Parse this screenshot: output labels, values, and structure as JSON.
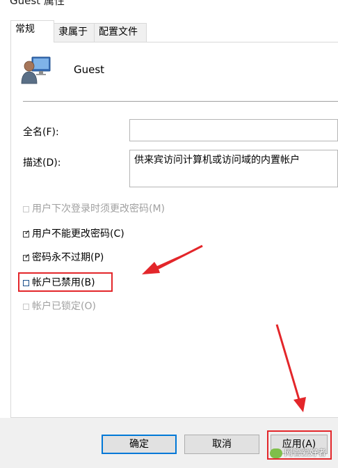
{
  "window": {
    "title": "Guest 属性"
  },
  "tabs": [
    {
      "label": "常规",
      "active": true
    },
    {
      "label": "隶属于",
      "active": false
    },
    {
      "label": "配置文件",
      "active": false
    }
  ],
  "user": {
    "icon": "user-monitor-icon",
    "name": "Guest"
  },
  "form": {
    "fullname_label": "全名(F):",
    "fullname_value": "",
    "description_label": "描述(D):",
    "description_value": "供来宾访问计算机或访问域的内置帐户"
  },
  "checkboxes": [
    {
      "label": "用户下次登录时须更改密码(M)",
      "checked": false,
      "disabled": true
    },
    {
      "label": "用户不能更改密码(C)",
      "checked": true,
      "disabled": false
    },
    {
      "label": "密码永不过期(P)",
      "checked": true,
      "disabled": false
    },
    {
      "label": "帐户已禁用(B)",
      "checked": false,
      "disabled": false
    },
    {
      "label": "帐户已锁定(O)",
      "checked": false,
      "disabled": true
    }
  ],
  "buttons": {
    "ok": "确定",
    "cancel": "取消",
    "apply": "应用(A)"
  },
  "watermark": "网管爱好者",
  "colors": {
    "annotation_red": "#e3262a",
    "focus_blue": "#0078d7",
    "button_face": "#e1e1e1",
    "dialog_background": "#f0f0f0"
  }
}
